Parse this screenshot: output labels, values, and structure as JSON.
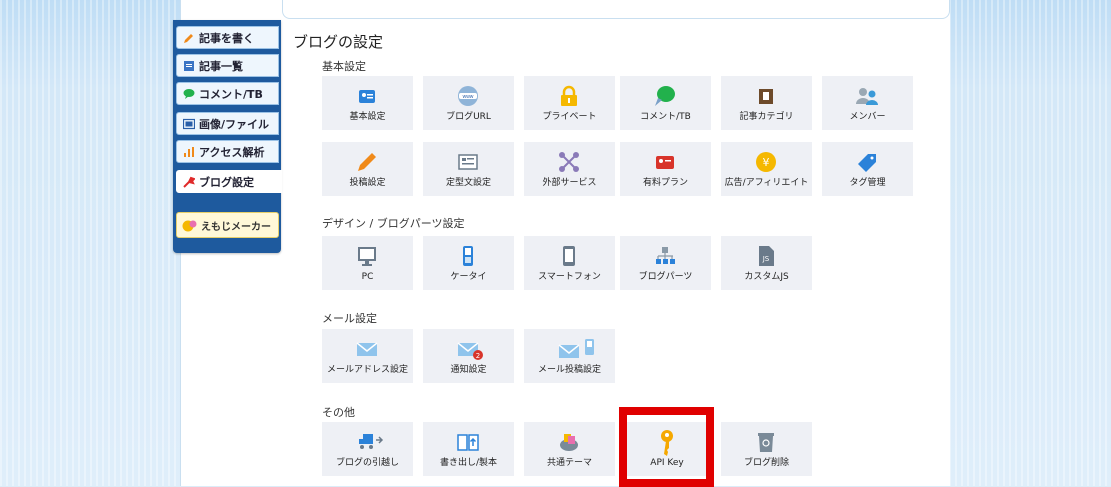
{
  "sidebar": {
    "items": [
      {
        "label": "記事を書く"
      },
      {
        "label": "記事一覧"
      },
      {
        "label": "コメント/TB"
      },
      {
        "label": "画像/ファイル"
      },
      {
        "label": "アクセス解析"
      },
      {
        "label": "ブログ設定"
      }
    ],
    "emoji_maker": "えもじメーカー"
  },
  "main": {
    "title": "ブログの設定",
    "sections": [
      {
        "heading": "基本設定",
        "tiles": [
          "基本設定",
          "ブログURL",
          "プライベート",
          "コメント/TB",
          "記事カテゴリ",
          "メンバー",
          "投稿設定",
          "定型文設定",
          "外部サービス",
          "有料プラン",
          "広告/アフィリエイト",
          "タグ管理"
        ]
      },
      {
        "heading": "デザイン / ブログパーツ設定",
        "tiles": [
          "PC",
          "ケータイ",
          "スマートフォン",
          "ブログパーツ",
          "カスタムJS"
        ]
      },
      {
        "heading": "メール設定",
        "tiles": [
          "メールアドレス設定",
          "通知設定",
          "メール投稿設定"
        ]
      },
      {
        "heading": "その他",
        "tiles": [
          "ブログの引越し",
          "書き出し/製本",
          "共通テーマ",
          "API Key",
          "ブログ削除"
        ]
      }
    ]
  },
  "colors": {
    "sidebar": "#1e5a9e",
    "tile_bg": "#eef0f5",
    "highlight": "#e00000"
  }
}
